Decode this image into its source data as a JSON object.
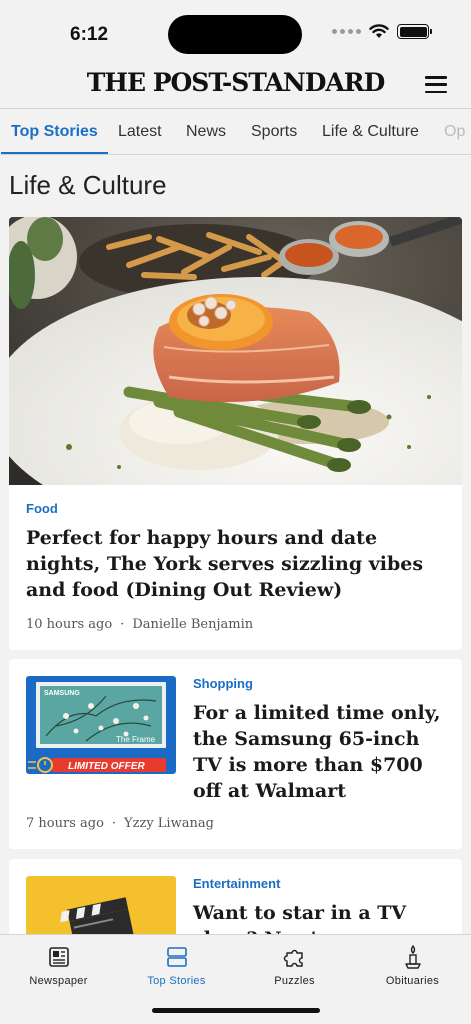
{
  "status": {
    "time": "6:12"
  },
  "header": {
    "masthead": "THE POST-STANDARD"
  },
  "tabs": [
    {
      "label": "Top Stories",
      "active": true
    },
    {
      "label": "Latest"
    },
    {
      "label": "News"
    },
    {
      "label": "Sports"
    },
    {
      "label": "Life & Culture"
    },
    {
      "label": "Op"
    }
  ],
  "section": {
    "title": "Life & Culture"
  },
  "articles": [
    {
      "category": "Food",
      "headline": "Perfect for happy hours and date nights, The York serves sizzling vibes and food (Dining Out Review)",
      "time": "10 hours ago",
      "author": "Danielle Benjamin",
      "image": "salmon-dish-photo"
    },
    {
      "category": "Shopping",
      "headline": "For a limited time only, the Samsung 65-inch TV is more than $700 off at Walmart",
      "time": "7 hours ago",
      "author": "Yzzy Liwanag",
      "image": "samsung-frame-tv",
      "thumb_brand": "SAMSUNG",
      "thumb_product": "The Frame",
      "thumb_badge": "LIMITED OFFER"
    },
    {
      "category": "Entertainment",
      "headline": "Want to star in a TV show? Now's your chance",
      "image": "clapperboard"
    }
  ],
  "bottom_nav": [
    {
      "label": "Newspaper",
      "icon": "newspaper-icon"
    },
    {
      "label": "Top Stories",
      "icon": "stories-icon",
      "active": true
    },
    {
      "label": "Puzzles",
      "icon": "puzzle-icon"
    },
    {
      "label": "Obituaries",
      "icon": "candle-icon"
    }
  ],
  "colors": {
    "accent": "#1a6fc4",
    "background": "#f2f2f2",
    "card": "#ffffff",
    "badge": "#e63b2e"
  }
}
